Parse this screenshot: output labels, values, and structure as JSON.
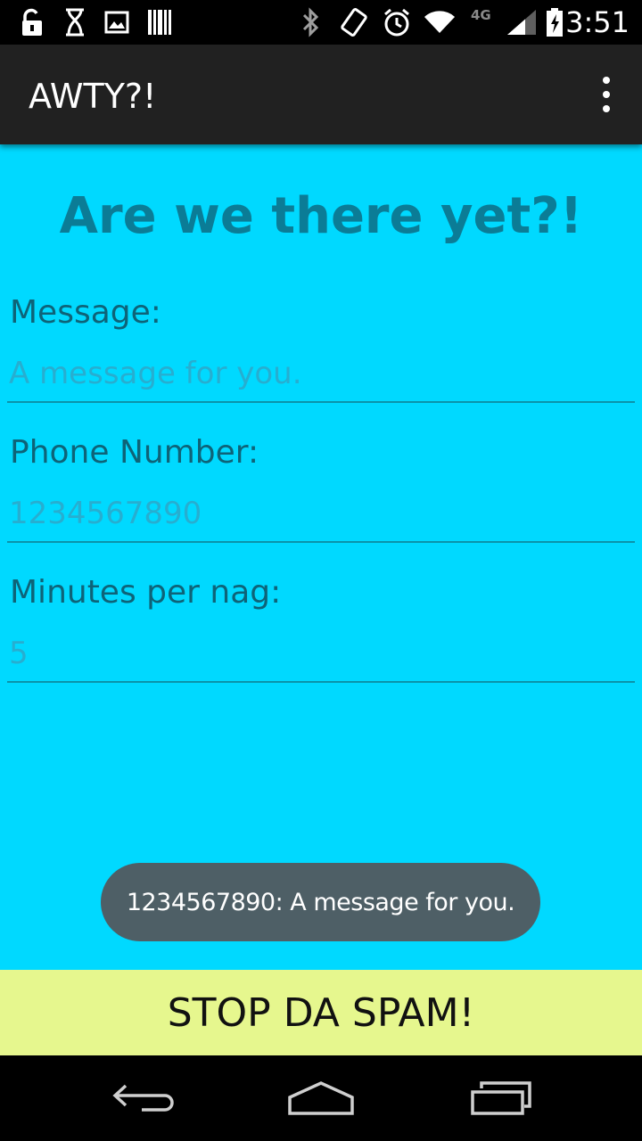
{
  "status_bar": {
    "time": "3:51",
    "network_label": "4G",
    "icons": [
      "unlock-icon",
      "hourglass-icon",
      "image-icon",
      "barcode-icon",
      "bluetooth-icon",
      "rotation-icon",
      "alarm-icon",
      "wifi-icon",
      "signal-icon",
      "battery-charging-icon"
    ]
  },
  "action_bar": {
    "title": "AWTY?!",
    "overflow_icon": "overflow-menu-icon"
  },
  "form": {
    "heading": "Are we there yet?!",
    "message": {
      "label": "Message:",
      "placeholder": "A message for you."
    },
    "phone": {
      "label": "Phone Number:",
      "placeholder": "1234567890"
    },
    "minutes": {
      "label": "Minutes per nag:",
      "placeholder": "5"
    }
  },
  "toast": {
    "text": "1234567890: A message for you."
  },
  "stop_button": {
    "label": "STOP DA SPAM!"
  },
  "nav_bar": {
    "icons": [
      "back-icon",
      "home-icon",
      "recent-apps-icon"
    ]
  },
  "colors": {
    "background": "#00d9ff",
    "heading": "#0b7c96",
    "action_bar": "#212121",
    "button": "#e6f78e",
    "toast": "#4e5f66"
  }
}
